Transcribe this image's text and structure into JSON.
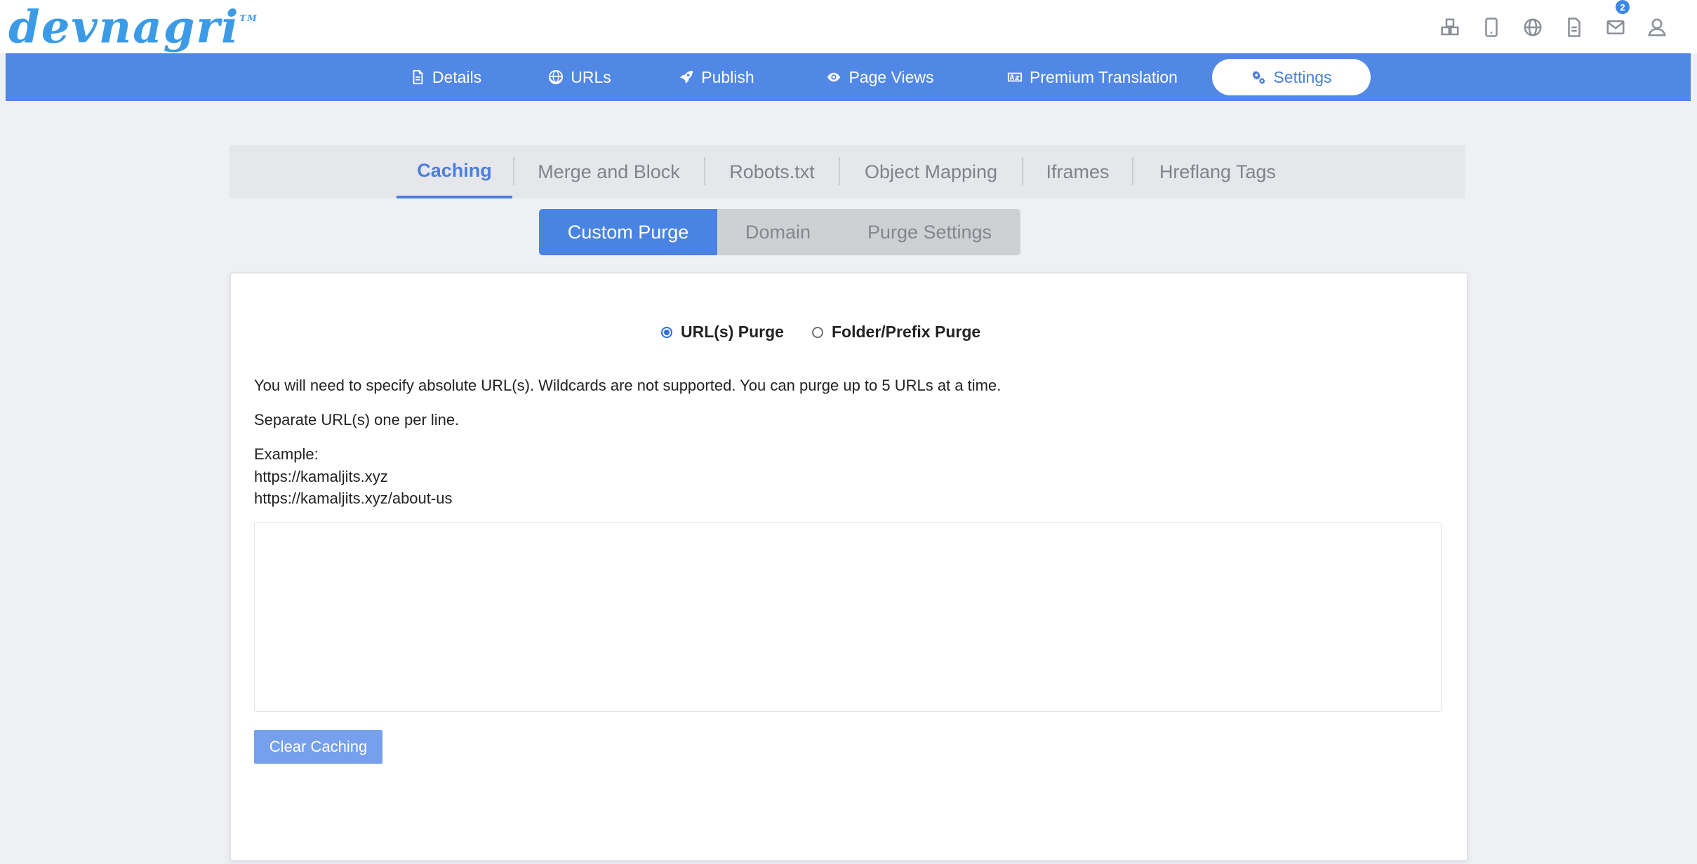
{
  "brand": {
    "logo_text": "devnagri",
    "trademark": "TM"
  },
  "header": {
    "icons": [
      "boxes-icon",
      "mobile-icon",
      "globe-icon",
      "document-icon",
      "mail-icon",
      "user-icon"
    ],
    "notification_count": "2"
  },
  "nav": {
    "items": [
      {
        "label": "Details",
        "icon": "file-icon"
      },
      {
        "label": "URLs",
        "icon": "globe-icon"
      },
      {
        "label": "Publish",
        "icon": "rocket-icon"
      },
      {
        "label": "Page Views",
        "icon": "eye-icon"
      },
      {
        "label": "Premium Translation",
        "icon": "language-icon"
      },
      {
        "label": "Settings",
        "icon": "gears-icon",
        "active": true
      }
    ]
  },
  "tabs": {
    "items": [
      "Caching",
      "Merge and Block",
      "Robots.txt",
      "Object Mapping",
      "Iframes",
      "Hreflang Tags"
    ],
    "active": "Caching"
  },
  "subtabs": {
    "items": [
      "Custom Purge",
      "Domain",
      "Purge Settings"
    ],
    "active": "Custom Purge"
  },
  "purge": {
    "options": [
      "URL(s) Purge",
      "Folder/Prefix Purge"
    ],
    "selected": "URL(s) Purge",
    "instruction": "You will need to specify absolute URL(s). Wildcards are not supported. You can purge up to 5 URLs at a time.",
    "separator_note": "Separate URL(s) one per line.",
    "example_label": "Example:",
    "example_urls": [
      "https://kamaljits.xyz",
      "https://kamaljits.xyz/about-us"
    ],
    "textarea_value": "",
    "button_label": "Clear Caching"
  },
  "colors": {
    "nav_bg": "#5187e5",
    "accent": "#4a7fdd",
    "button": "#76a0ec",
    "badge": "#3b87e8"
  }
}
